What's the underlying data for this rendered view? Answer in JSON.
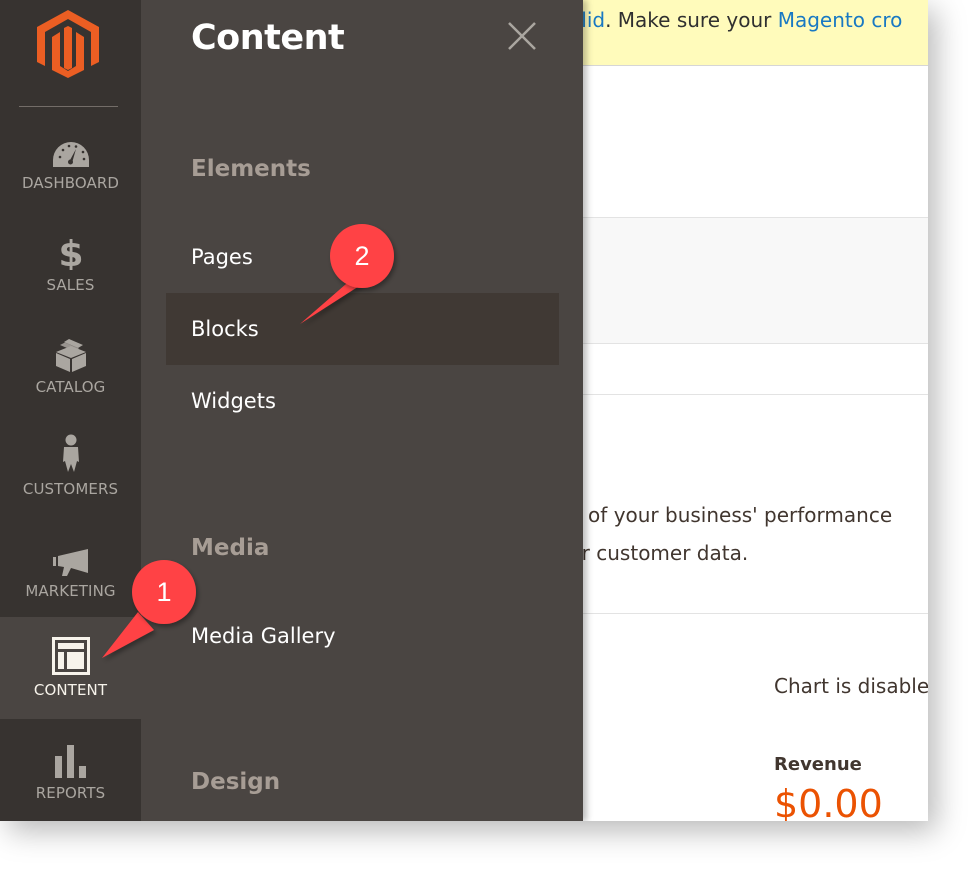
{
  "sidebar": {
    "logo": "magento-logo",
    "items": [
      {
        "label": "DASHBOARD",
        "icon": "dashboard-gauge-icon",
        "active": false
      },
      {
        "label": "SALES",
        "icon": "dollar-icon",
        "active": false
      },
      {
        "label": "CATALOG",
        "icon": "box-icon",
        "active": false
      },
      {
        "label": "CUSTOMERS",
        "icon": "person-icon",
        "active": false
      },
      {
        "label": "MARKETING",
        "icon": "megaphone-icon",
        "active": false
      },
      {
        "label": "CONTENT",
        "icon": "layout-icon",
        "active": true
      },
      {
        "label": "REPORTS",
        "icon": "bar-chart-icon",
        "active": false
      }
    ]
  },
  "flyout": {
    "title": "Content",
    "close_icon": "close-icon",
    "sections": [
      {
        "heading": "Elements",
        "items": [
          "Pages",
          "Blocks",
          "Widgets"
        ]
      },
      {
        "heading": "Media",
        "items": [
          "Media Gallery"
        ]
      },
      {
        "heading": "Design",
        "items": []
      }
    ],
    "highlighted_item": "Blocks"
  },
  "main": {
    "notice": {
      "prefix_link": "alid",
      "text": ". Make sure your ",
      "suffix_link": "Magento cro"
    },
    "intro_lines": [
      "d of your business' performance",
      "ur customer data."
    ],
    "chart_disabled_text": "Chart is disable",
    "revenue_label": "Revenue",
    "revenue_value": "$0.00"
  },
  "callouts": [
    {
      "number": "1",
      "color": "#ff4245",
      "target": "CONTENT"
    },
    {
      "number": "2",
      "color": "#ff4245",
      "target": "Blocks"
    }
  ],
  "colors": {
    "nav_bg": "#373330",
    "flyout_bg": "#4a4542",
    "accent_orange": "#eb5202",
    "link_blue": "#1979c3",
    "notice_bg": "#fffbbb"
  }
}
